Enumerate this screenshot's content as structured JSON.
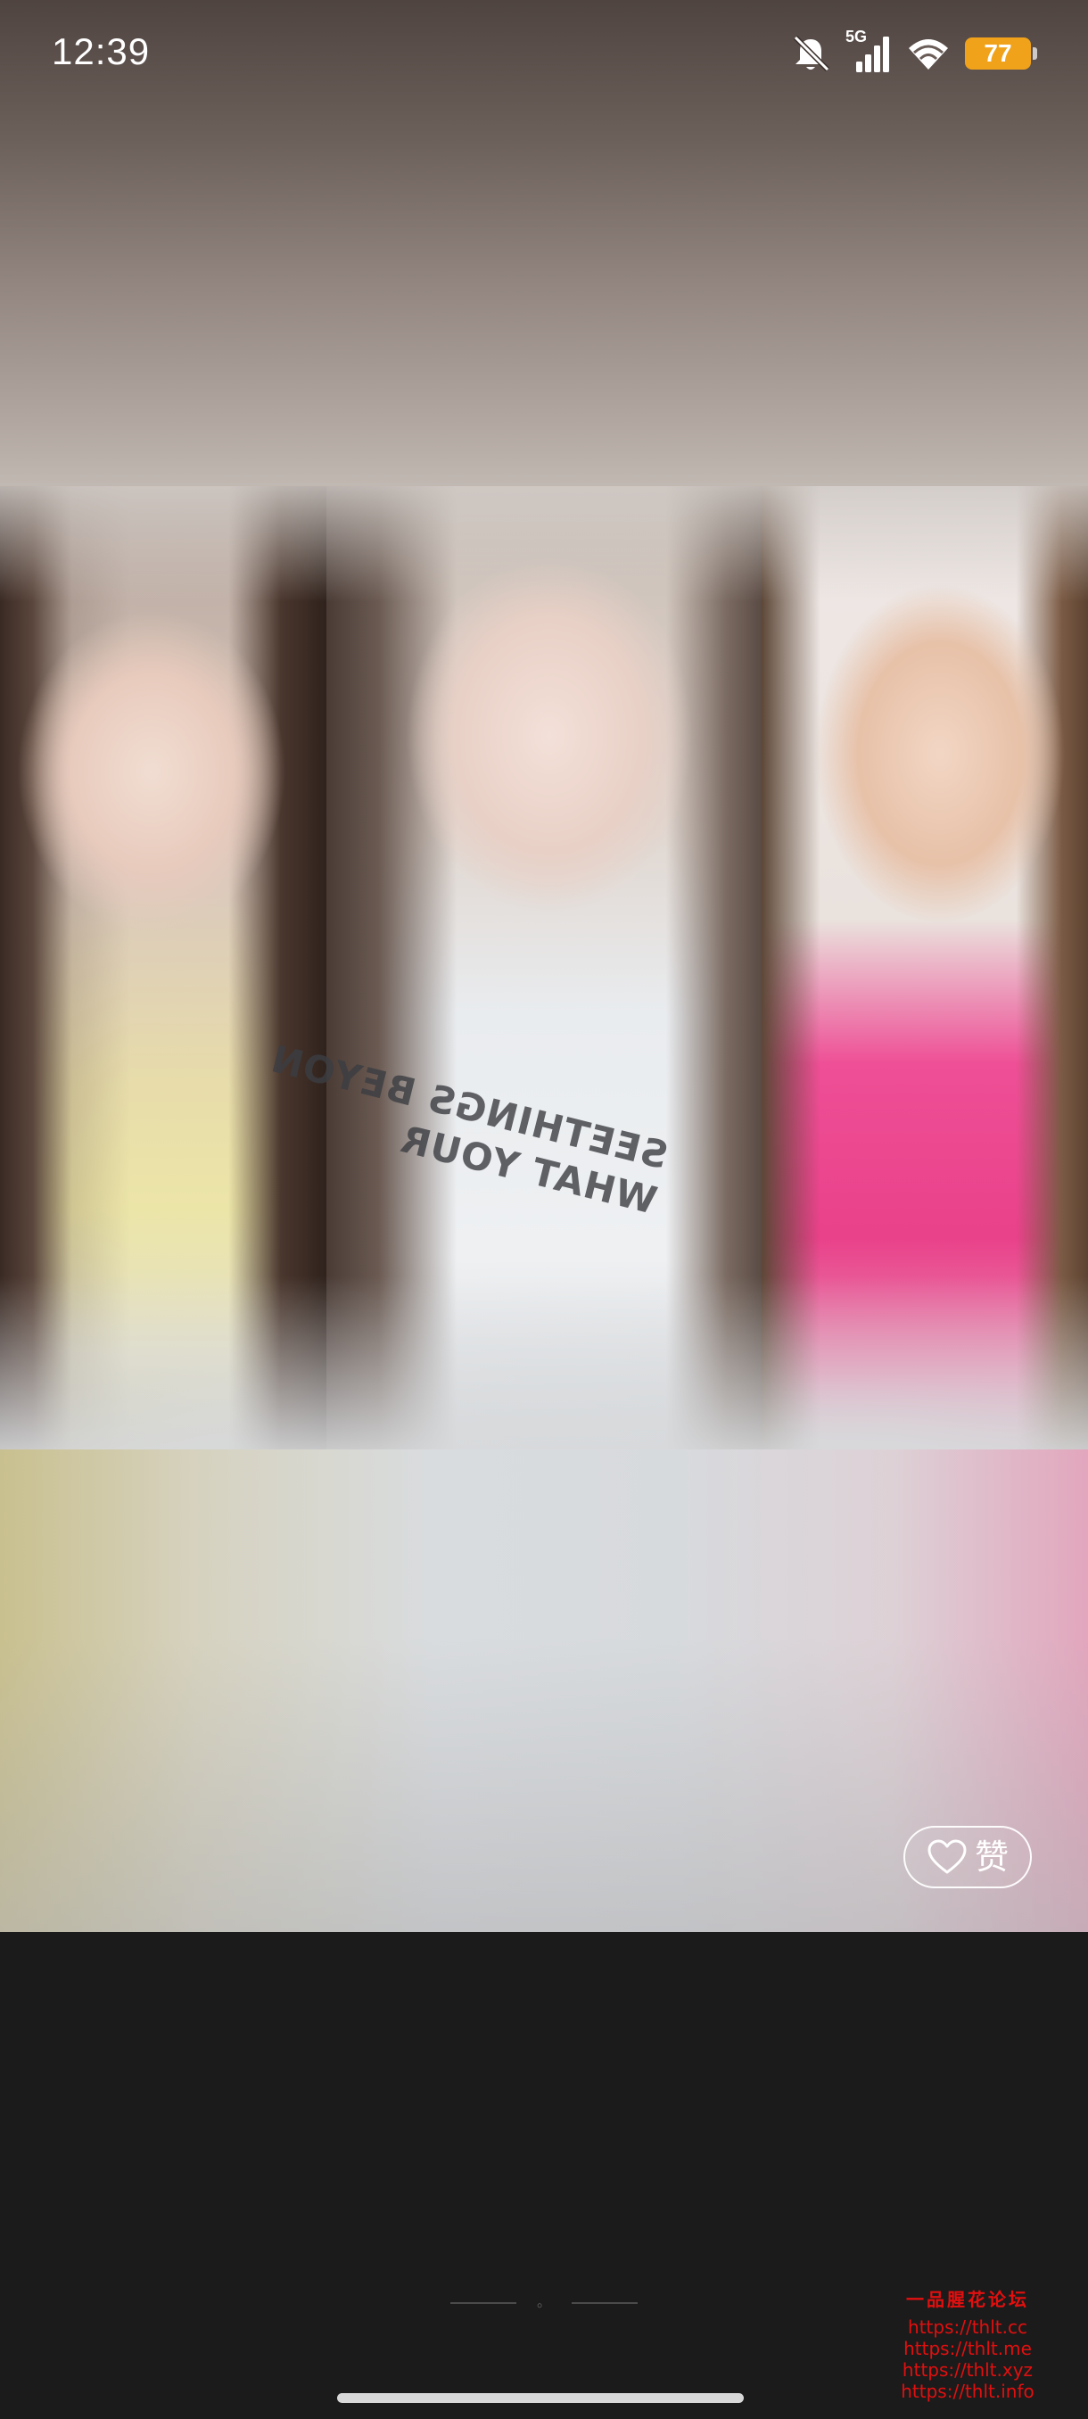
{
  "status_bar": {
    "time": "12:39",
    "network_label": "5G",
    "battery_level": "77",
    "icons": [
      "bell-mute-icon",
      "cellular-signal-icon",
      "wifi-icon",
      "battery-icon"
    ]
  },
  "photo_strip": {
    "photos": [
      {
        "name": "photo-left"
      },
      {
        "name": "photo-center"
      },
      {
        "name": "photo-right"
      }
    ],
    "shirt_text_line_1": "SEETHINGS BEYON",
    "shirt_text_line_2": "WHAT YOUR"
  },
  "like_button": {
    "label": "赞",
    "icon": "heart-icon"
  },
  "divider": {
    "mark": "。"
  },
  "watermark": {
    "title": "一品腥花论坛",
    "urls": [
      "https://thlt.cc",
      "https://thlt.me",
      "https://thlt.xyz",
      "https://thlt.info"
    ],
    "color": "#e30f0f"
  },
  "colors": {
    "background": "#1b1b1b",
    "battery": "#f0a21a"
  }
}
